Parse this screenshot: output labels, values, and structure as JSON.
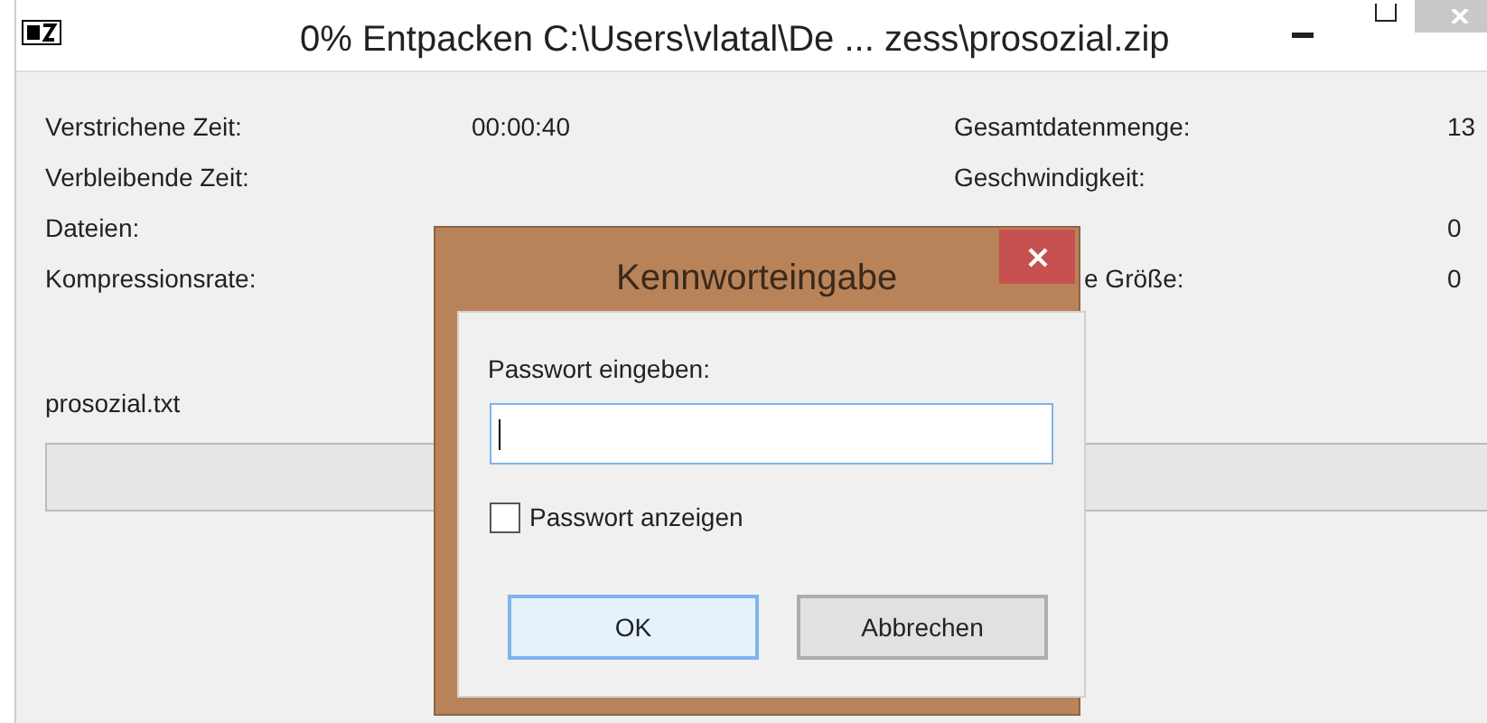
{
  "window": {
    "title": "0% Entpacken C:\\Users\\vlatal\\De ... zess\\prosozial.zip"
  },
  "stats_left": [
    {
      "label": "Verstrichene Zeit:",
      "value": "00:00:40"
    },
    {
      "label": "Verbleibende Zeit:"
    },
    {
      "label": "Dateien:"
    },
    {
      "label": "Kompressionsrate:"
    }
  ],
  "stats_right": [
    {
      "label": "Gesamtdatenmenge:",
      "value": "13"
    },
    {
      "label": "Geschwindigkeit:"
    },
    {
      "value": "0"
    },
    {
      "label": "e Größe:",
      "value": "0"
    }
  ],
  "current_file": "prosozial.txt",
  "progress": {
    "level": 0
  },
  "dialog": {
    "title": "Kennworteingabe",
    "prompt": "Passwort eingeben:",
    "show_password": {
      "label": "Passwort anzeigen",
      "checked": false
    },
    "buttons": [
      {
        "label": "OK",
        "default": true
      },
      {
        "label": "Abbrechen",
        "default": false
      }
    ]
  }
}
